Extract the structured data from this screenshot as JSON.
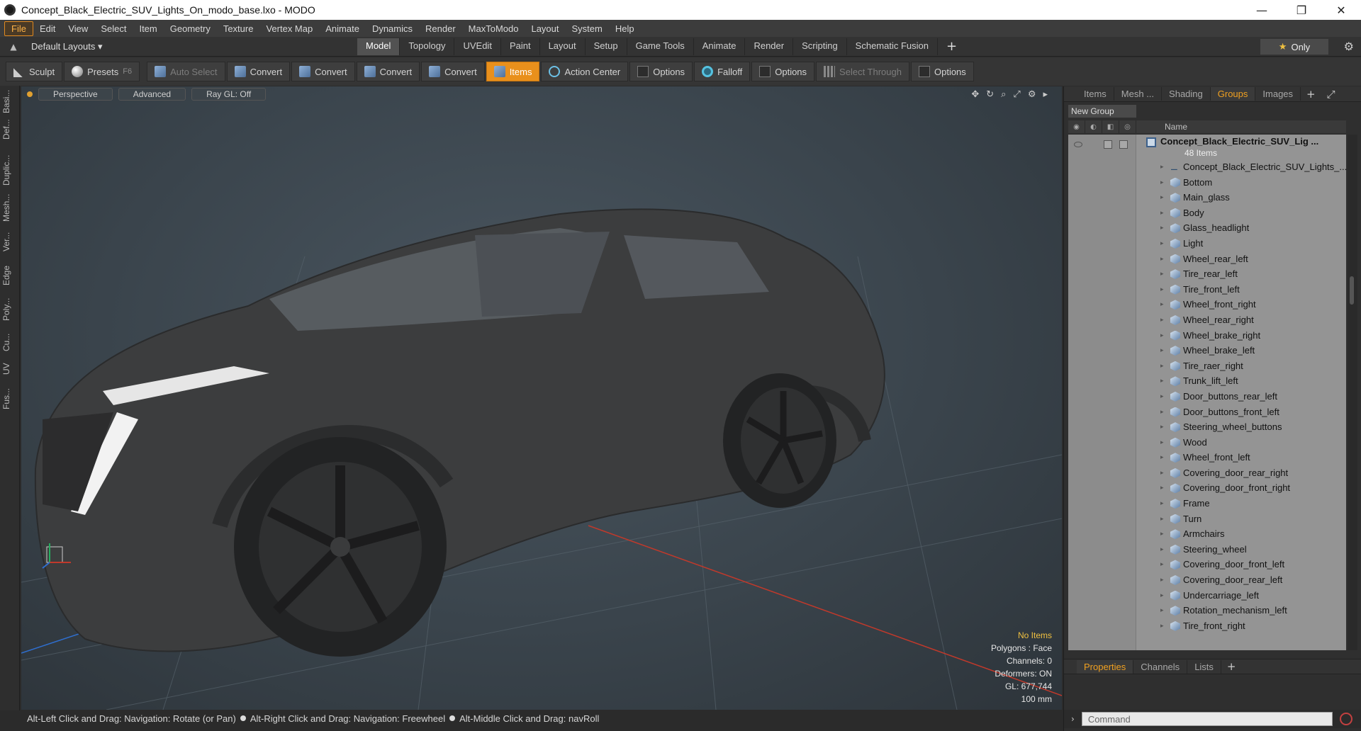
{
  "window": {
    "title": "Concept_Black_Electric_SUV_Lights_On_modo_base.lxo - MODO",
    "controls": {
      "minimize": "—",
      "maximize": "❐",
      "close": "✕"
    }
  },
  "menubar": {
    "items": [
      "File",
      "Edit",
      "View",
      "Select",
      "Item",
      "Geometry",
      "Texture",
      "Vertex Map",
      "Animate",
      "Dynamics",
      "Render",
      "MaxToModo",
      "Layout",
      "System",
      "Help"
    ],
    "active": "File"
  },
  "layoutbar": {
    "layout_selector": "Default Layouts ▾",
    "tabs": [
      "Model",
      "Topology",
      "UVEdit",
      "Paint",
      "Layout",
      "Setup",
      "Game Tools",
      "Animate",
      "Render",
      "Scripting",
      "Schematic Fusion"
    ],
    "active_tab": "Model",
    "add": "+",
    "only_label": "Only"
  },
  "toolbar": {
    "sculpt": "Sculpt",
    "presets": "Presets",
    "presets_key": "F6",
    "auto_select": "Auto Select",
    "convert1": "Convert",
    "convert2": "Convert",
    "convert3": "Convert",
    "convert4": "Convert",
    "items": "Items",
    "action_center": "Action Center",
    "options1": "Options",
    "falloff": "Falloff",
    "options2": "Options",
    "select_through": "Select Through",
    "options3": "Options"
  },
  "leftstrip": {
    "tabs": [
      "Basi...",
      "Def...",
      "Duplic...",
      "Mesh...",
      "Ver...",
      "Edge",
      "Poly...",
      "Cu...",
      "UV",
      "Fus..."
    ]
  },
  "viewport": {
    "view_mode": "Perspective",
    "shading": "Advanced",
    "ray_gl": "Ray GL: Off",
    "stats": {
      "selection": "No Items",
      "polygons": "Polygons : Face",
      "channels": "Channels: 0",
      "deformers": "Deformers: ON",
      "gl": "GL: 677,744",
      "scale": "100 mm"
    },
    "colors": {
      "body": "#3a3a3a",
      "bg": "#3a444c",
      "x_axis": "#c0392b",
      "y_axis": "#27ae60",
      "z_axis": "#2f6fd0"
    }
  },
  "statusbar": {
    "hint1": "Alt-Left Click and Drag: Navigation: Rotate (or Pan)",
    "hint2": "Alt-Right Click and Drag: Navigation: Freewheel",
    "hint3": "Alt-Middle Click and Drag: navRoll"
  },
  "rightpanel": {
    "tabs": [
      "Items",
      "Mesh ...",
      "Shading",
      "Groups",
      "Images"
    ],
    "active_tab": "Groups",
    "new_group": "New Group",
    "column_name": "Name",
    "root": {
      "name": "Concept_Black_Electric_SUV_Lig ...",
      "count": "48 Items"
    },
    "items": [
      "Concept_Black_Electric_SUV_Lights_...",
      "Bottom",
      "Main_glass",
      "Body",
      "Glass_headlight",
      "Light",
      "Wheel_rear_left",
      "Tire_rear_left",
      "Tire_front_left",
      "Wheel_front_right",
      "Wheel_rear_right",
      "Wheel_brake_right",
      "Wheel_brake_left",
      "Tire_raer_right",
      "Trunk_lift_left",
      "Door_buttons_rear_left",
      "Door_buttons_front_left",
      "Steering_wheel_buttons",
      "Wood",
      "Wheel_front_left",
      "Covering_door_rear_right",
      "Covering_door_front_right",
      "Frame",
      "Turn",
      "Armchairs",
      "Steering_wheel",
      "Covering_door_front_left",
      "Covering_door_rear_left",
      "Undercarriage_left",
      "Rotation_mechanism_left",
      "Tire_front_right"
    ],
    "bottom_tabs": [
      "Properties",
      "Channels",
      "Lists"
    ],
    "bottom_active": "Properties",
    "command_placeholder": "Command"
  }
}
